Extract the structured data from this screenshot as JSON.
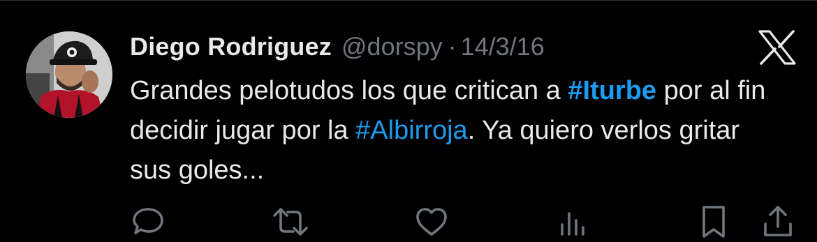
{
  "tweet": {
    "author": {
      "display_name": "Diego Rodriguez",
      "handle": "@dorspy"
    },
    "separator": "·",
    "date": "14/3/16",
    "text": {
      "part1": "Grandes pelotudos los que critican a ",
      "hashtag1": "#Iturbe",
      "part2": " por al fin decidir jugar por la ",
      "hashtag2": "#Albirroja",
      "part3": ". Ya quiero verlos gritar sus goles..."
    }
  },
  "icons": {
    "brand": "x-logo-icon",
    "actions": [
      "reply-icon",
      "retweet-icon",
      "like-icon",
      "views-icon",
      "bookmark-icon",
      "share-icon"
    ]
  },
  "colors": {
    "background": "#000000",
    "text": "#e7e9ea",
    "secondary": "#71767b",
    "link": "#1d9bf0"
  }
}
